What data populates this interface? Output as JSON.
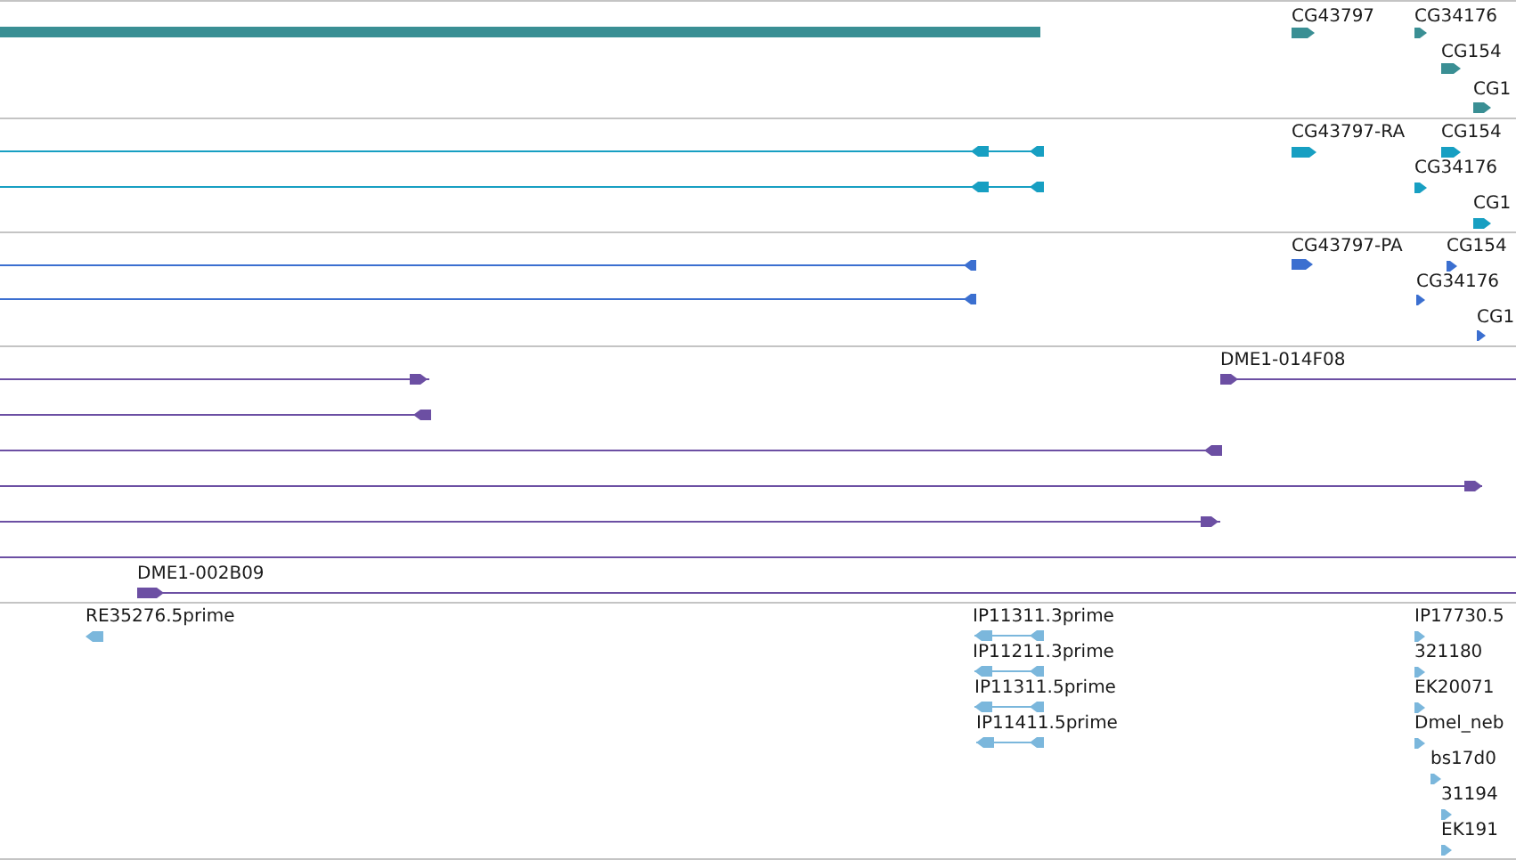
{
  "tracks": [
    {
      "color": "#3a8f94",
      "features": [
        {
          "label": "CG43797",
          "reverse": false
        },
        {
          "label": "CG34176",
          "reverse": false
        },
        {
          "label": "CG154",
          "reverse": false
        },
        {
          "label": "CG1",
          "reverse": false
        }
      ]
    },
    {
      "color": "#179fc2",
      "features": [
        {
          "label": "CG43797-RA",
          "reverse": false
        },
        {
          "label": "CG154",
          "reverse": false
        },
        {
          "label": "CG34176",
          "reverse": false
        },
        {
          "label": "CG1",
          "reverse": false
        }
      ]
    },
    {
      "color": "#3b6fd0",
      "features": [
        {
          "label": "CG43797-PA",
          "reverse": false
        },
        {
          "label": "CG154",
          "reverse": false
        },
        {
          "label": "CG34176",
          "reverse": false
        },
        {
          "label": "CG1",
          "reverse": false
        }
      ]
    },
    {
      "color": "#6c4fa3",
      "features": [
        {
          "label": "DME1-014F08",
          "reverse": false
        },
        {
          "label": "DME1-002B09",
          "reverse": false
        }
      ]
    },
    {
      "color": "#7bb7dc",
      "features": [
        {
          "label": "RE35276.5prime",
          "reverse": true
        },
        {
          "label": "IP11311.3prime",
          "reverse": true
        },
        {
          "label": "IP11211.3prime",
          "reverse": true
        },
        {
          "label": "IP11311.5prime",
          "reverse": true
        },
        {
          "label": "IP11411.5prime",
          "reverse": true
        },
        {
          "label": "IP17730.5",
          "reverse": false
        },
        {
          "label": "321180",
          "reverse": false
        },
        {
          "label": "EK20071",
          "reverse": false
        },
        {
          "label": "Dmel_neb",
          "reverse": false
        },
        {
          "label": "bs17d0",
          "reverse": false
        },
        {
          "label": "31194",
          "reverse": false
        },
        {
          "label": "EK191",
          "reverse": false
        }
      ]
    }
  ]
}
